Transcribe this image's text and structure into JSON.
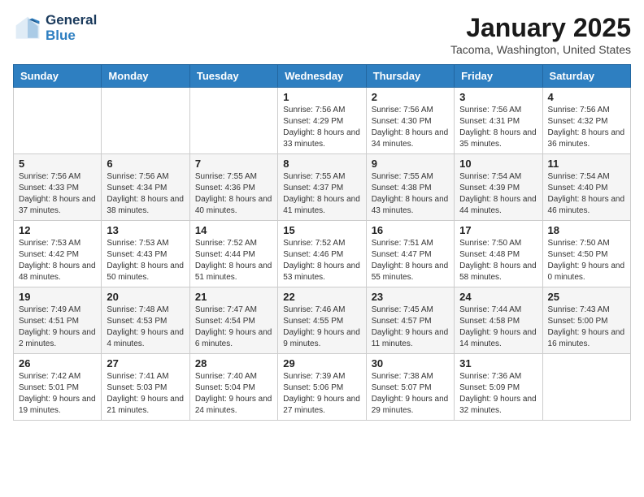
{
  "logo": {
    "line1": "General",
    "line2": "Blue"
  },
  "title": "January 2025",
  "location": "Tacoma, Washington, United States",
  "weekdays": [
    "Sunday",
    "Monday",
    "Tuesday",
    "Wednesday",
    "Thursday",
    "Friday",
    "Saturday"
  ],
  "weeks": [
    [
      {
        "day": "",
        "sunrise": "",
        "sunset": "",
        "daylight": ""
      },
      {
        "day": "",
        "sunrise": "",
        "sunset": "",
        "daylight": ""
      },
      {
        "day": "",
        "sunrise": "",
        "sunset": "",
        "daylight": ""
      },
      {
        "day": "1",
        "sunrise": "Sunrise: 7:56 AM",
        "sunset": "Sunset: 4:29 PM",
        "daylight": "Daylight: 8 hours and 33 minutes."
      },
      {
        "day": "2",
        "sunrise": "Sunrise: 7:56 AM",
        "sunset": "Sunset: 4:30 PM",
        "daylight": "Daylight: 8 hours and 34 minutes."
      },
      {
        "day": "3",
        "sunrise": "Sunrise: 7:56 AM",
        "sunset": "Sunset: 4:31 PM",
        "daylight": "Daylight: 8 hours and 35 minutes."
      },
      {
        "day": "4",
        "sunrise": "Sunrise: 7:56 AM",
        "sunset": "Sunset: 4:32 PM",
        "daylight": "Daylight: 8 hours and 36 minutes."
      }
    ],
    [
      {
        "day": "5",
        "sunrise": "Sunrise: 7:56 AM",
        "sunset": "Sunset: 4:33 PM",
        "daylight": "Daylight: 8 hours and 37 minutes."
      },
      {
        "day": "6",
        "sunrise": "Sunrise: 7:56 AM",
        "sunset": "Sunset: 4:34 PM",
        "daylight": "Daylight: 8 hours and 38 minutes."
      },
      {
        "day": "7",
        "sunrise": "Sunrise: 7:55 AM",
        "sunset": "Sunset: 4:36 PM",
        "daylight": "Daylight: 8 hours and 40 minutes."
      },
      {
        "day": "8",
        "sunrise": "Sunrise: 7:55 AM",
        "sunset": "Sunset: 4:37 PM",
        "daylight": "Daylight: 8 hours and 41 minutes."
      },
      {
        "day": "9",
        "sunrise": "Sunrise: 7:55 AM",
        "sunset": "Sunset: 4:38 PM",
        "daylight": "Daylight: 8 hours and 43 minutes."
      },
      {
        "day": "10",
        "sunrise": "Sunrise: 7:54 AM",
        "sunset": "Sunset: 4:39 PM",
        "daylight": "Daylight: 8 hours and 44 minutes."
      },
      {
        "day": "11",
        "sunrise": "Sunrise: 7:54 AM",
        "sunset": "Sunset: 4:40 PM",
        "daylight": "Daylight: 8 hours and 46 minutes."
      }
    ],
    [
      {
        "day": "12",
        "sunrise": "Sunrise: 7:53 AM",
        "sunset": "Sunset: 4:42 PM",
        "daylight": "Daylight: 8 hours and 48 minutes."
      },
      {
        "day": "13",
        "sunrise": "Sunrise: 7:53 AM",
        "sunset": "Sunset: 4:43 PM",
        "daylight": "Daylight: 8 hours and 50 minutes."
      },
      {
        "day": "14",
        "sunrise": "Sunrise: 7:52 AM",
        "sunset": "Sunset: 4:44 PM",
        "daylight": "Daylight: 8 hours and 51 minutes."
      },
      {
        "day": "15",
        "sunrise": "Sunrise: 7:52 AM",
        "sunset": "Sunset: 4:46 PM",
        "daylight": "Daylight: 8 hours and 53 minutes."
      },
      {
        "day": "16",
        "sunrise": "Sunrise: 7:51 AM",
        "sunset": "Sunset: 4:47 PM",
        "daylight": "Daylight: 8 hours and 55 minutes."
      },
      {
        "day": "17",
        "sunrise": "Sunrise: 7:50 AM",
        "sunset": "Sunset: 4:48 PM",
        "daylight": "Daylight: 8 hours and 58 minutes."
      },
      {
        "day": "18",
        "sunrise": "Sunrise: 7:50 AM",
        "sunset": "Sunset: 4:50 PM",
        "daylight": "Daylight: 9 hours and 0 minutes."
      }
    ],
    [
      {
        "day": "19",
        "sunrise": "Sunrise: 7:49 AM",
        "sunset": "Sunset: 4:51 PM",
        "daylight": "Daylight: 9 hours and 2 minutes."
      },
      {
        "day": "20",
        "sunrise": "Sunrise: 7:48 AM",
        "sunset": "Sunset: 4:53 PM",
        "daylight": "Daylight: 9 hours and 4 minutes."
      },
      {
        "day": "21",
        "sunrise": "Sunrise: 7:47 AM",
        "sunset": "Sunset: 4:54 PM",
        "daylight": "Daylight: 9 hours and 6 minutes."
      },
      {
        "day": "22",
        "sunrise": "Sunrise: 7:46 AM",
        "sunset": "Sunset: 4:55 PM",
        "daylight": "Daylight: 9 hours and 9 minutes."
      },
      {
        "day": "23",
        "sunrise": "Sunrise: 7:45 AM",
        "sunset": "Sunset: 4:57 PM",
        "daylight": "Daylight: 9 hours and 11 minutes."
      },
      {
        "day": "24",
        "sunrise": "Sunrise: 7:44 AM",
        "sunset": "Sunset: 4:58 PM",
        "daylight": "Daylight: 9 hours and 14 minutes."
      },
      {
        "day": "25",
        "sunrise": "Sunrise: 7:43 AM",
        "sunset": "Sunset: 5:00 PM",
        "daylight": "Daylight: 9 hours and 16 minutes."
      }
    ],
    [
      {
        "day": "26",
        "sunrise": "Sunrise: 7:42 AM",
        "sunset": "Sunset: 5:01 PM",
        "daylight": "Daylight: 9 hours and 19 minutes."
      },
      {
        "day": "27",
        "sunrise": "Sunrise: 7:41 AM",
        "sunset": "Sunset: 5:03 PM",
        "daylight": "Daylight: 9 hours and 21 minutes."
      },
      {
        "day": "28",
        "sunrise": "Sunrise: 7:40 AM",
        "sunset": "Sunset: 5:04 PM",
        "daylight": "Daylight: 9 hours and 24 minutes."
      },
      {
        "day": "29",
        "sunrise": "Sunrise: 7:39 AM",
        "sunset": "Sunset: 5:06 PM",
        "daylight": "Daylight: 9 hours and 27 minutes."
      },
      {
        "day": "30",
        "sunrise": "Sunrise: 7:38 AM",
        "sunset": "Sunset: 5:07 PM",
        "daylight": "Daylight: 9 hours and 29 minutes."
      },
      {
        "day": "31",
        "sunrise": "Sunrise: 7:36 AM",
        "sunset": "Sunset: 5:09 PM",
        "daylight": "Daylight: 9 hours and 32 minutes."
      },
      {
        "day": "",
        "sunrise": "",
        "sunset": "",
        "daylight": ""
      }
    ]
  ]
}
